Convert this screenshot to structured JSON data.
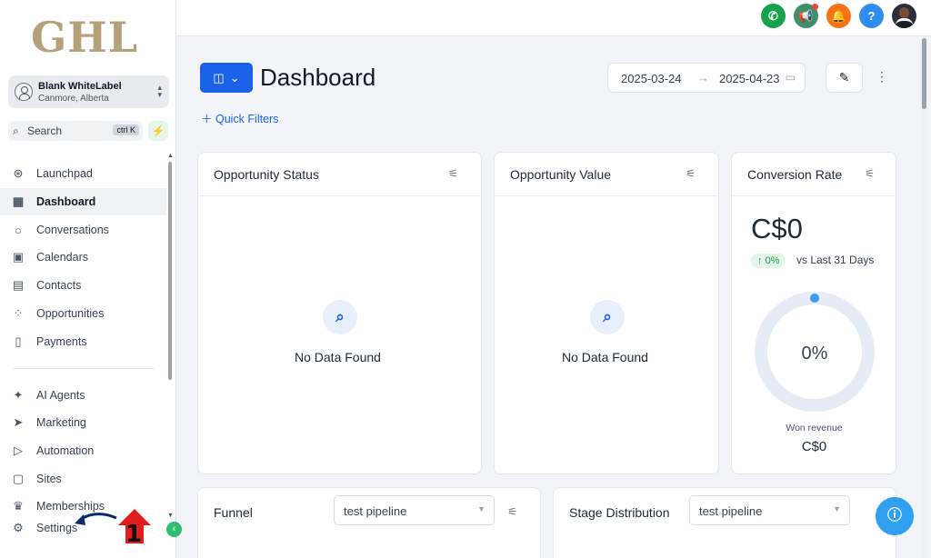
{
  "brand": {
    "logo_text": "GHL"
  },
  "account": {
    "name": "Blank WhiteLabel",
    "location": "Canmore, Alberta"
  },
  "search": {
    "label": "Search",
    "shortcut": "ctrl K"
  },
  "sidebar": {
    "items": [
      {
        "label": "Launchpad",
        "icon": "rocket-icon"
      },
      {
        "label": "Dashboard",
        "icon": "grid-icon",
        "active": true
      },
      {
        "label": "Conversations",
        "icon": "chat-icon"
      },
      {
        "label": "Calendars",
        "icon": "calendar-icon"
      },
      {
        "label": "Contacts",
        "icon": "contacts-icon"
      },
      {
        "label": "Opportunities",
        "icon": "opportunities-icon"
      },
      {
        "label": "Payments",
        "icon": "payments-icon"
      },
      {
        "label": "AI Agents",
        "icon": "sparkle-icon"
      },
      {
        "label": "Marketing",
        "icon": "send-icon"
      },
      {
        "label": "Automation",
        "icon": "play-icon"
      },
      {
        "label": "Sites",
        "icon": "sites-icon"
      },
      {
        "label": "Memberships",
        "icon": "membership-icon"
      },
      {
        "label": "Settings",
        "icon": "gear-icon"
      }
    ]
  },
  "annotation": {
    "step": "1"
  },
  "header": {
    "title": "Dashboard",
    "quick_filters": "Quick Filters",
    "date_from": "2025-03-24",
    "date_to": "2025-04-23"
  },
  "cards": {
    "opportunity_status": {
      "title": "Opportunity Status",
      "empty": "No Data Found"
    },
    "opportunity_value": {
      "title": "Opportunity Value",
      "empty": "No Data Found"
    },
    "conversion_rate": {
      "title": "Conversion Rate",
      "value": "C$0",
      "change": "0%",
      "compare": "vs Last 31 Days",
      "gauge_label": "0%",
      "gauge_fraction": 0,
      "won_label": "Won revenue",
      "won_value": "C$0"
    },
    "funnel": {
      "title": "Funnel",
      "pipeline": "test pipeline"
    },
    "stage_distribution": {
      "title": "Stage Distribution",
      "pipeline": "test pipeline"
    }
  },
  "colors": {
    "primary": "#1a62ea",
    "accent_green": "#2fbf71",
    "badge_green": "#16a34a",
    "chat_blue": "#2f9ff0"
  }
}
